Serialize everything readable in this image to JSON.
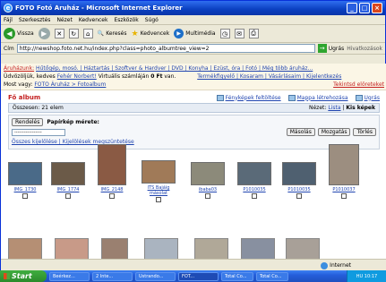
{
  "window": {
    "title": "FOTO Fotó Áruház - Microsoft Internet Explorer",
    "controls": [
      "_",
      "□",
      "×"
    ]
  },
  "menu": [
    "Fájl",
    "Szerkesztés",
    "Nézet",
    "Kedvencek",
    "Eszközök",
    "Súgó"
  ],
  "toolbar": {
    "back": "Vissza",
    "search": "Keresés",
    "favorites": "Kedvencek",
    "media": "Multimédia"
  },
  "address": {
    "label": "Cím",
    "url": "http://newshop.foto.net.hu/index.php?class=photo_albumtree_view=2",
    "go": "Ugrás",
    "links": "Hivatkozások"
  },
  "shop": {
    "line1_label": "Áruházunk:",
    "line1_links": "Hűtőgép, mosó. | Háztartás | Szoftver & Hardver | DVD | Konyha | Ezüst, óra | Fotó | Még több áruház...",
    "line2_prefix": "Üdvözöljük, kedves",
    "user": "Fehér Norbert!",
    "line2_mid": "Virtuális számláján",
    "balance": "0 Ft",
    "line2_suffix": "van.",
    "line2_links": "Termékfigyelő | Kosaram | Vásárlásaim | Kijelentkezés",
    "line3_prefix": "Most vagy:",
    "line3_path": "FOTO Áruház > Fotoalbum",
    "line3_right": "Tekintsd elöreteket"
  },
  "album": {
    "title": "Fő album",
    "actions": [
      "Fényképek feltöltése",
      "Mappa létrehozása",
      "Ugrás"
    ],
    "count": "Összesen: 21 elem",
    "view_label": "Nézet:",
    "view_list": "Lista",
    "view_sep": "|",
    "view_small": "Kis képek",
    "order_btn": "Rendelés",
    "paper_label": "Papírkép mérete:",
    "paper_value": "-----------------",
    "copy_btn": "Másolás",
    "move_btn": "Mozgatás",
    "delete_btn": "Törlés",
    "select_links": "Összes kijelölése | Kijelölések megszüntetése"
  },
  "thumbnails": [
    {
      "caption": "IMG_1730",
      "color": "#4a6a88"
    },
    {
      "caption": "IMG_1774",
      "color": "#6b5a48"
    },
    {
      "caption": "IMG_2148",
      "color": "#8a5a44"
    },
    {
      "caption": "ITS Bajáig másolat",
      "color": "#a07a58"
    },
    {
      "caption": "ibaba03",
      "color": "#8c8a7a"
    },
    {
      "caption": "P1010035",
      "color": "#5a6a78"
    },
    {
      "caption": "P1010035",
      "color": "#4f6070"
    },
    {
      "caption": "P1010037",
      "color": "#9c8e80"
    }
  ],
  "status": {
    "zone": "Internet"
  },
  "taskbar": {
    "start": "Start",
    "items": [
      "Beérkez...",
      "2 Inte...",
      "Ustrando...",
      "FOT...",
      "Total Co...",
      "Total Co..."
    ],
    "clock": "HU  10:17"
  }
}
